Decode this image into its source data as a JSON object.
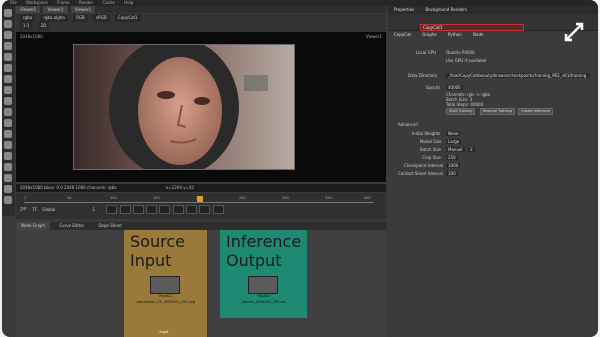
{
  "menu": [
    "File",
    "Workspace",
    "Frame",
    "Render",
    "Cache",
    "Help"
  ],
  "viewer": {
    "tabs": [
      "Viewer1",
      "Viewer1",
      "Viewer1"
    ],
    "toolbar_top": [
      "rgba",
      "rgba.alpha",
      "RGB",
      "sRGB",
      "CopyCat1"
    ],
    "toolbar_bottom": [
      "1:1",
      "2D"
    ],
    "label_tl": "2048x1080",
    "label_tr": "Viewer1",
    "info": "2048x1080  bbox: 0 0 2048 1080 channels: rgba",
    "info_right": "x=1269 y=42"
  },
  "timeline": {
    "ticks": [
      "1",
      "50",
      "100",
      "150",
      "200",
      "250",
      "300",
      "350",
      "400"
    ],
    "fps": "24*",
    "tf": "TF",
    "global": "Global",
    "frame": "1"
  },
  "props": {
    "tabs": [
      "Properties",
      "Background Renders"
    ],
    "node_name": "CopyCat1",
    "subtabs": [
      "CopyCat",
      "Graphs",
      "Python",
      "Node"
    ],
    "local_gpu_label": "Local GPU",
    "local_gpu_value": "Quadro P4000",
    "use_gpu": "Use GPU if available",
    "data_dir_label": "Data Directory",
    "data_dir_value": "_final/CopyCat/beauty/browse/checkpoints/training_962_vIt1/training",
    "epochs_label": "Epochs",
    "epochs_value": "40000",
    "channels": "Channels: rgb -> rgba",
    "batch_size_info": "Batch Size: 3",
    "total_steps": "Total Steps: 40000",
    "start_btn": "Start Training",
    "resume_btn": "Resume Training",
    "create_btn": "Create Inference",
    "advanced": "Advanced",
    "initial_weights_label": "Initial Weights",
    "initial_weights_value": "None",
    "model_size_label": "Model Size",
    "model_size_value": "Large",
    "batch_size_label": "Batch Size",
    "batch_size_mode": "Manual",
    "batch_size_value": "3",
    "crop_size_label": "Crop Size",
    "crop_size_value": "256",
    "checkpoint_label": "Checkpoint Interval",
    "checkpoint_value": "1000",
    "contact_label": "Contact Sheet Interval",
    "contact_value": "100"
  },
  "nodegraph": {
    "tabs": [
      "Node Graph",
      "Curve Editor",
      "Dope Sheet"
    ],
    "source_title": "Source Input",
    "inference_title": "Inference Output",
    "src_node_name": "Read22",
    "src_node_file": "production_35_4025952_155.png",
    "inf_node_name": "Read23",
    "inf_node_file": "Source_4035452_155.exr",
    "src_connector": "Input"
  }
}
